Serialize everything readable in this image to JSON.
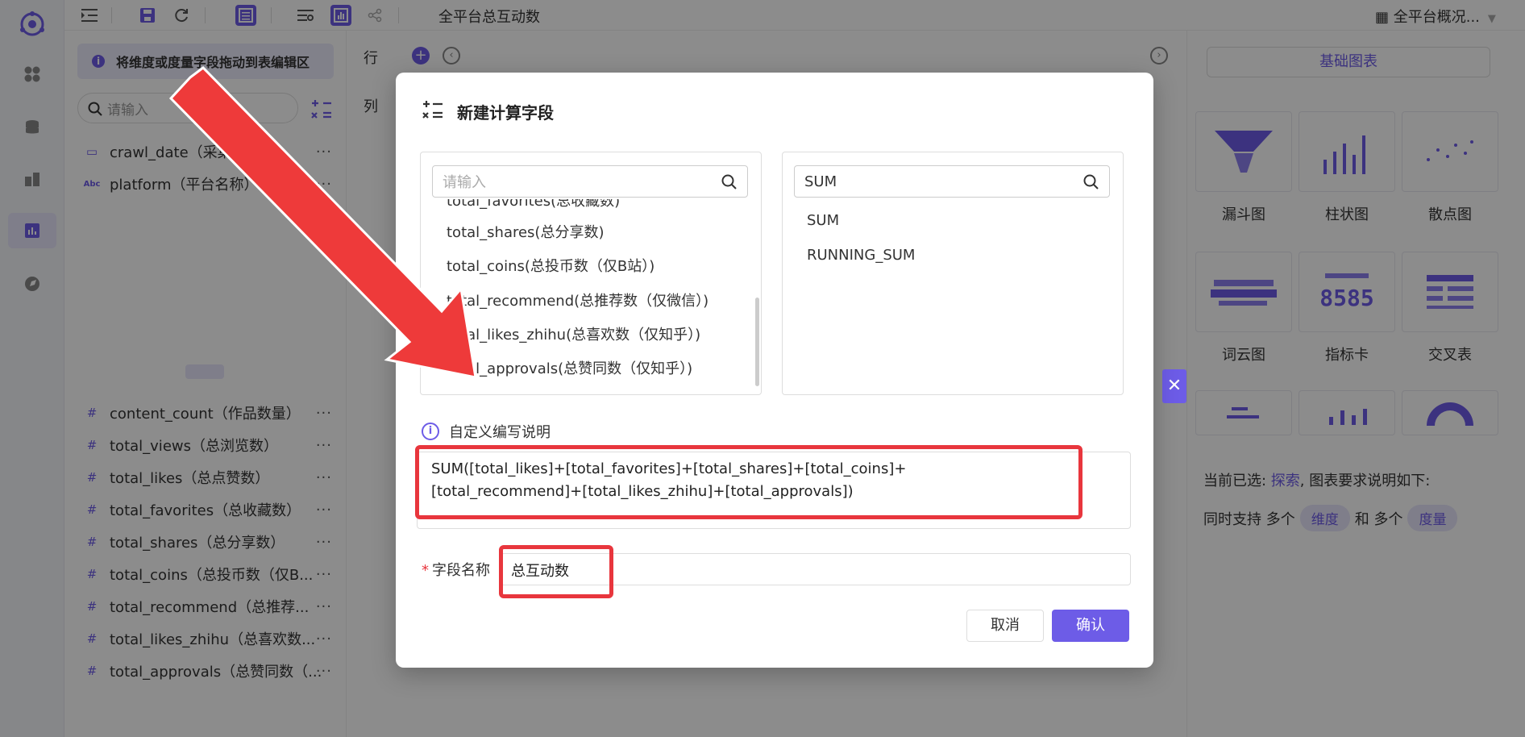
{
  "toolbar": {
    "chart_title": "全平台总互动数",
    "overview_label": "全平台概况..."
  },
  "field_panel": {
    "hint": "将维度或度量字段拖动到表编辑区",
    "search_placeholder": "请输入",
    "dimensions": [
      {
        "type_icon": "calendar-icon",
        "label": "crawl_date（采集日期）"
      },
      {
        "type_icon": "abc-icon",
        "label": "platform（平台名称）"
      }
    ],
    "measures": [
      "content_count（作品数量）",
      "total_views（总浏览数）",
      "total_likes（总点赞数）",
      "total_favorites（总收藏数）",
      "total_shares（总分享数）",
      "total_coins（总投币数（仅B...",
      "total_recommend（总推荐...",
      "total_likes_zhihu（总喜欢数...",
      "total_approvals（总赞同数（..."
    ],
    "more": "···",
    "measure_prefix": "#",
    "abc_text": "Abc"
  },
  "editor": {
    "row_label": "行",
    "col_label": "列"
  },
  "right_panel": {
    "basic_tab": "基础图表",
    "charts": [
      "漏斗图",
      "柱状图",
      "散点图",
      "词云图",
      "指标卡",
      "交叉表"
    ],
    "metric_card_value": "8585",
    "req_prefix": "当前已选: ",
    "req_link": "探索",
    "req_suffix": ", 图表要求说明如下:",
    "support_prefix": "同时支持 多个",
    "dimension_pill": "维度",
    "support_and": "和 多个",
    "measure_pill": "度量"
  },
  "modal": {
    "title": "新建计算字段",
    "left_search_placeholder": "请输入",
    "left_fields": [
      "total_favorites(总收藏数)",
      "total_shares(总分享数)",
      "total_coins(总投币数（仅B站）)",
      "total_recommend(总推荐数（仅微信）)",
      "total_likes_zhihu(总喜欢数（仅知乎）)",
      "total_approvals(总赞同数（仅知乎）)"
    ],
    "right_search_value": "SUM",
    "functions": [
      "SUM",
      "RUNNING_SUM"
    ],
    "custom_info": "自定义编写说明",
    "formula": "SUM([total_likes]+[total_favorites]+[total_shares]+[total_coins]+[total_recommend]+[total_likes_zhihu]+[total_approvals])",
    "name_label": "字段名称",
    "name_required_mark": "*",
    "name_value": "总互动数",
    "cancel": "取消",
    "confirm": "确认",
    "close": "✕"
  },
  "colors": {
    "accent": "#6d5ce7",
    "highlight": "#e8363d"
  }
}
